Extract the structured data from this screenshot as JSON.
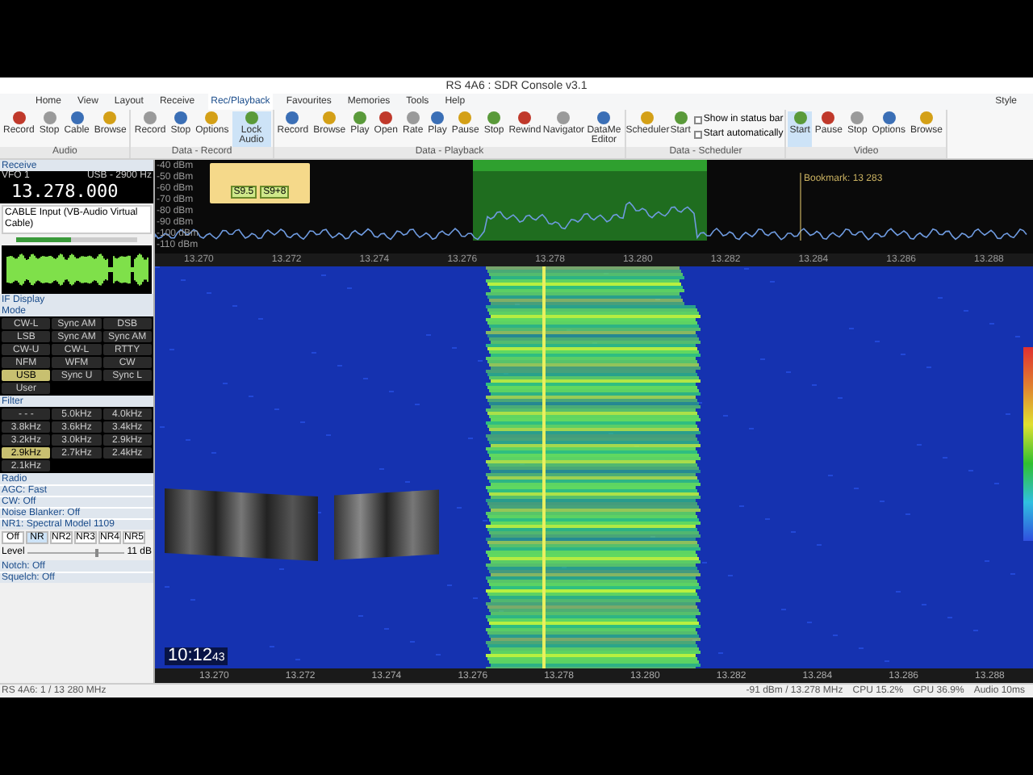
{
  "window": {
    "title": "RS 4A6 : SDR Console v3.1"
  },
  "menu": [
    {
      "label": "Home",
      "selected": false
    },
    {
      "label": "View",
      "selected": false
    },
    {
      "label": "Layout",
      "selected": false
    },
    {
      "label": "Receive",
      "selected": false
    },
    {
      "label": "Rec/Playback",
      "selected": true
    },
    {
      "label": "Favourites",
      "selected": false
    },
    {
      "label": "Memories",
      "selected": false
    },
    {
      "label": "Tools",
      "selected": false
    },
    {
      "label": "Help",
      "selected": false
    }
  ],
  "ribbon_groups": [
    {
      "label": "Audio",
      "buttons": [
        {
          "label": "Record",
          "selected": false
        },
        {
          "label": "Stop",
          "selected": false
        },
        {
          "label": "Cable",
          "selected": false
        },
        {
          "label": "Browse",
          "selected": false
        }
      ]
    },
    {
      "label": "Data - Record",
      "buttons": [
        {
          "label": "Record",
          "selected": false
        },
        {
          "label": "Stop",
          "selected": false
        },
        {
          "label": "Options",
          "selected": false
        },
        {
          "label": "Lock Audio",
          "selected": true
        }
      ]
    },
    {
      "label": "Data - Playback",
      "buttons": [
        {
          "label": "Record",
          "selected": false
        },
        {
          "label": "Browse",
          "selected": false
        },
        {
          "label": "Play",
          "selected": false
        },
        {
          "label": "Open",
          "selected": false
        },
        {
          "label": "Rate",
          "selected": false
        },
        {
          "label": "Play",
          "selected": false
        },
        {
          "label": "Pause",
          "selected": false
        },
        {
          "label": "Stop",
          "selected": false
        },
        {
          "label": "Rewind",
          "selected": false
        },
        {
          "label": "Navigator",
          "selected": false
        },
        {
          "label": "DataMe Editor",
          "selected": false
        }
      ]
    },
    {
      "label": "Data - Scheduler",
      "buttons": [
        {
          "label": "Scheduler",
          "selected": false
        },
        {
          "label": "Start",
          "selected": false
        }
      ],
      "checks": [
        {
          "label": "Show in status bar",
          "checked": false
        },
        {
          "label": "Start automatically",
          "checked": false
        }
      ]
    },
    {
      "label": "Video",
      "buttons": [
        {
          "label": "Start",
          "selected": true
        },
        {
          "label": "Pause",
          "selected": false
        },
        {
          "label": "Stop",
          "selected": false
        },
        {
          "label": "Options",
          "selected": false
        },
        {
          "label": "Browse",
          "selected": false
        }
      ]
    }
  ],
  "style_label": "Style",
  "receive": {
    "title": "Receive",
    "vfo": "VFO 1",
    "bandwidth": "USB - 2900 Hz",
    "frequency": "13.278.000",
    "audio_device": "CABLE Input (VB-Audio Virtual Cable)",
    "volume": {
      "level": 0.45
    }
  },
  "if_display": {
    "title": "IF Display"
  },
  "mode": {
    "title": "Mode",
    "buttons": [
      {
        "label": "CW-L",
        "selected": false
      },
      {
        "label": "Sync AM",
        "selected": false
      },
      {
        "label": "DSB",
        "selected": false
      },
      {
        "label": "LSB",
        "selected": false
      },
      {
        "label": "Sync AM",
        "selected": false
      },
      {
        "label": "Sync AM",
        "selected": false
      },
      {
        "label": "CW-U",
        "selected": false
      },
      {
        "label": "CW-L",
        "selected": false
      },
      {
        "label": "RTTY",
        "selected": false
      },
      {
        "label": "NFM",
        "selected": false
      },
      {
        "label": "WFM",
        "selected": false
      },
      {
        "label": "CW",
        "selected": false
      },
      {
        "label": "USB",
        "selected": true
      },
      {
        "label": "Sync U",
        "selected": false
      },
      {
        "label": "Sync L",
        "selected": false
      },
      {
        "label": "User",
        "selected": false
      }
    ]
  },
  "filter": {
    "title": "Filter",
    "buttons": [
      {
        "label": "- - -",
        "selected": false
      },
      {
        "label": "5.0kHz",
        "selected": false
      },
      {
        "label": "4.0kHz",
        "selected": false
      },
      {
        "label": "3.8kHz",
        "selected": false
      },
      {
        "label": "3.6kHz",
        "selected": false
      },
      {
        "label": "3.4kHz",
        "selected": false
      },
      {
        "label": "3.2kHz",
        "selected": false
      },
      {
        "label": "3.0kHz",
        "selected": false
      },
      {
        "label": "2.9kHz",
        "selected": false
      },
      {
        "label": "2.9kHz",
        "selected": true
      },
      {
        "label": "2.7kHz",
        "selected": false
      },
      {
        "label": "2.4kHz",
        "selected": false
      },
      {
        "label": "2.1kHz",
        "selected": false
      }
    ]
  },
  "radio": {
    "title": "Radio",
    "rows": [
      "AGC: Fast",
      "CW: Off",
      "Noise Blanker: Off",
      "NR1: Spectral Model 1109"
    ]
  },
  "nr_buttons": [
    {
      "label": "Off",
      "selected": false
    },
    {
      "label": "NR",
      "selected": true
    },
    {
      "label": "NR2",
      "selected": false
    },
    {
      "label": "NR3",
      "selected": false
    },
    {
      "label": "NR4",
      "selected": false
    },
    {
      "label": "NR5",
      "selected": false
    }
  ],
  "level": {
    "label": "Level",
    "level": 0.7,
    "reading": "11 dB"
  },
  "notch": "Notch: Off",
  "squelch": "Squelch: Off",
  "spectrum": {
    "meter_readings": [
      "S9.5",
      "S9+8"
    ],
    "bookmark": "Bookmark: 13 283",
    "yticks": [
      "-40 dBm",
      "-50 dBm",
      "-60 dBm",
      "-70 dBm",
      "-80 dBm",
      "-90 dBm",
      "-100 dBm",
      "-110 dBm"
    ],
    "xticks": [
      "13.270",
      "13.272",
      "13.274",
      "13.276",
      "13.278",
      "13.280",
      "13.282",
      "13.284",
      "13.286",
      "13.288"
    ]
  },
  "clock": {
    "time": "10:12",
    "seconds": "43"
  },
  "freq_axis": [
    "13.270",
    "13.272",
    "13.274",
    "13.276",
    "13.278",
    "13.280",
    "13.282",
    "13.284",
    "13.286",
    "13.288"
  ],
  "status_bar": {
    "left": "RS 4A6: 1 / 13 280 MHz",
    "items": [
      "-91 dBm / 13.278 MHz",
      "CPU 15.2%",
      "GPU 36.9%",
      "Audio 10ms"
    ]
  }
}
